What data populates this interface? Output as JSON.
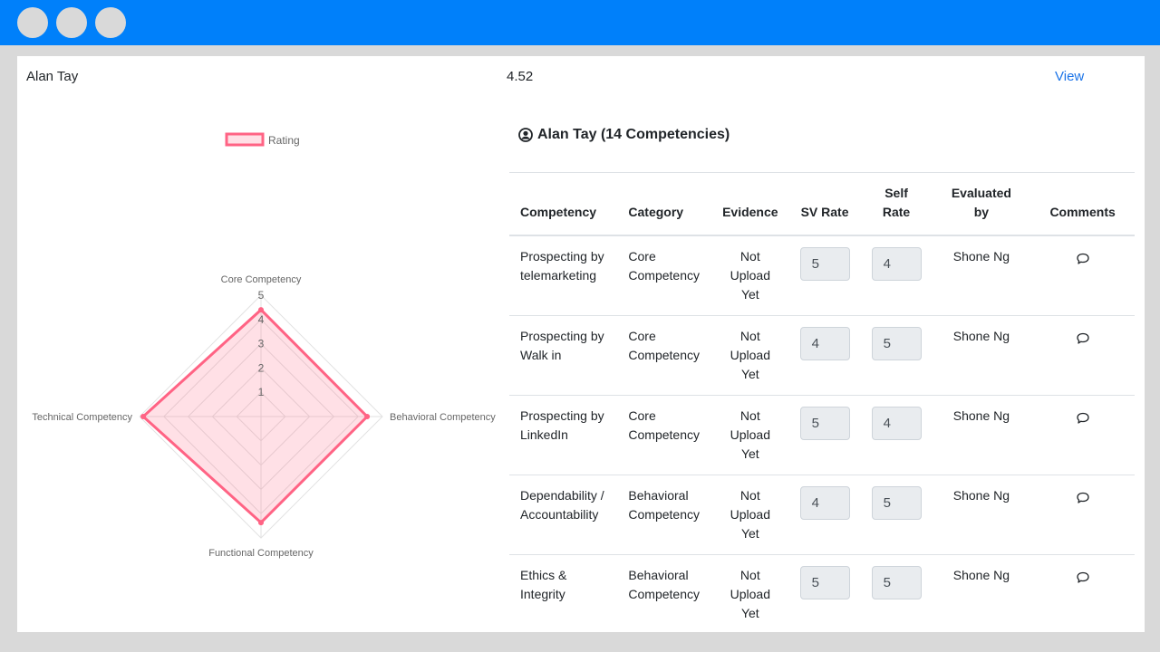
{
  "window": {
    "controls": [
      "circle",
      "circle",
      "circle"
    ]
  },
  "summary": {
    "employee_name": "Alan Tay",
    "score": "4.52",
    "view_link": "View"
  },
  "detail": {
    "title": "Alan Tay (14 Competencies)",
    "icon": "user-circle-icon"
  },
  "table": {
    "headers": {
      "competency": "Competency",
      "category": "Category",
      "evidence": "Evidence",
      "sv_rate": "SV Rate",
      "self_rate": "Self Rate",
      "evaluated_by": "Evaluated by",
      "comments": "Comments"
    },
    "rows": [
      {
        "competency": "Prospecting by telemarketing",
        "category": "Core Competency",
        "evidence": "Not Upload Yet",
        "sv_rate": "5",
        "self_rate": "4",
        "evaluated_by": "Shone Ng",
        "comment_icon": "chat-bubble-icon"
      },
      {
        "competency": "Prospecting by Walk in",
        "category": "Core Competency",
        "evidence": "Not Upload Yet",
        "sv_rate": "4",
        "self_rate": "5",
        "evaluated_by": "Shone Ng",
        "comment_icon": "chat-bubble-icon"
      },
      {
        "competency": "Prospecting by LinkedIn",
        "category": "Core Competency",
        "evidence": "Not Upload Yet",
        "sv_rate": "5",
        "self_rate": "4",
        "evaluated_by": "Shone Ng",
        "comment_icon": "chat-bubble-icon"
      },
      {
        "competency": "Dependability / Accountability",
        "category": "Behavioral Competency",
        "evidence": "Not Upload Yet",
        "sv_rate": "4",
        "self_rate": "5",
        "evaluated_by": "Shone Ng",
        "comment_icon": "chat-bubble-icon"
      },
      {
        "competency": "Ethics & Integrity",
        "category": "Behavioral Competency",
        "evidence": "Not Upload Yet",
        "sv_rate": "5",
        "self_rate": "5",
        "evaluated_by": "Shone Ng",
        "comment_icon": "chat-bubble-icon"
      }
    ]
  },
  "chart_data": {
    "type": "radar",
    "title": "",
    "legend": {
      "entries": [
        "Rating"
      ],
      "placement": "top"
    },
    "categories": [
      "Core Competency",
      "Behavioral Competency",
      "Functional Competency",
      "Technical Competency"
    ],
    "series": [
      {
        "name": "Rating",
        "values": [
          4.4,
          4.37,
          4.37,
          4.85
        ],
        "border_color": "#ff6384",
        "fill_color": "rgba(255,99,132,0.2)"
      }
    ],
    "r_ticks": [
      "1",
      "2",
      "3",
      "4",
      "5"
    ],
    "r_range": [
      0,
      5
    ],
    "grid": true
  }
}
